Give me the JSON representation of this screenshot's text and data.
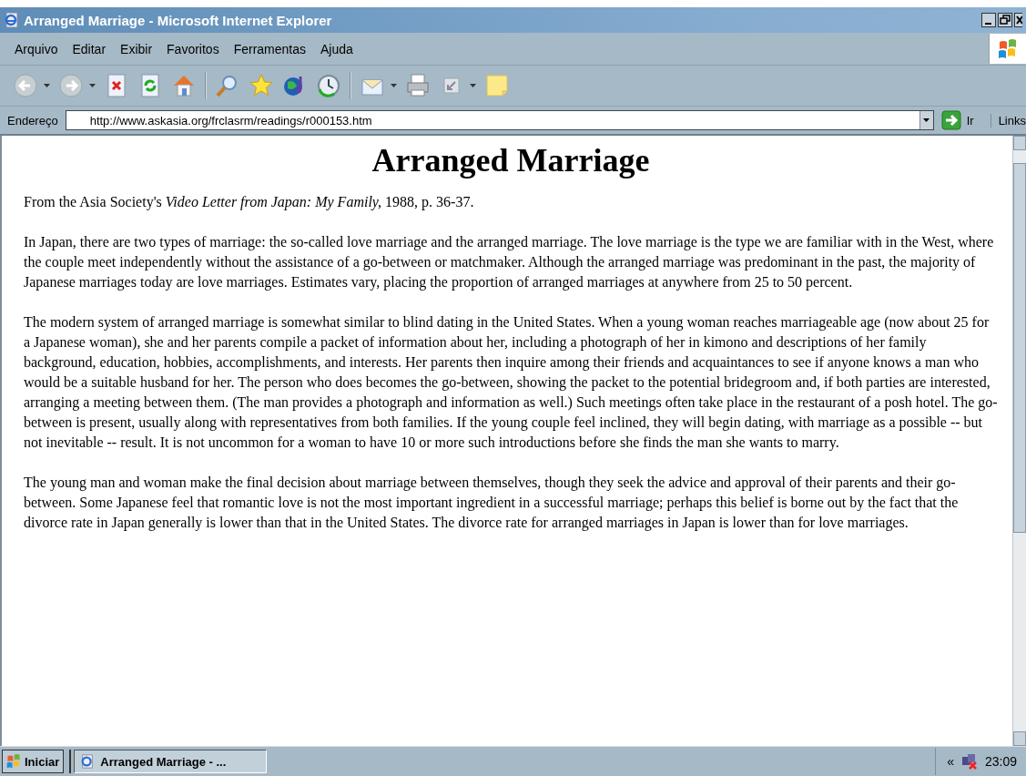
{
  "window": {
    "title": "Arranged Marriage - Microsoft Internet Explorer"
  },
  "menu": [
    "Arquivo",
    "Editar",
    "Exibir",
    "Favoritos",
    "Ferramentas",
    "Ajuda"
  ],
  "address_bar": {
    "label": "Endereço",
    "value": "http://www.askasia.org/frclasrm/readings/r000153.htm",
    "go": "Ir",
    "links": "Links"
  },
  "page": {
    "heading": "Arranged Marriage",
    "paragraphs": [
      "From the Asia Society's *Video Letter from Japan: My Family,* 1988, p. 36-37.",
      "In Japan, there are two types of marriage: the so-called love marriage and the arranged marriage. The love marriage is the type we are familiar with in the West, where the couple meet independently without the assistance of a go-between or matchmaker. Although the arranged marriage was predominant in the past, the majority of Japanese marriages today are love marriages. Estimates vary, placing the proportion of arranged marriages at anywhere from 25 to 50 percent.",
      "The modern system of arranged marriage is somewhat similar to blind dating in the United States. When a young woman reaches marriageable age (now about 25 for a Japanese woman), she and her parents compile a packet of information about her, including a photograph of her in kimono and descriptions of her family background, education, hobbies, accomplishments, and interests. Her parents then inquire among their friends and acquaintances to see if anyone knows a man who would be a suitable husband for her. The person who does becomes the go-between, showing the packet to the potential bridegroom and, if both parties are interested, arranging a meeting between them. (The man provides a photograph and information as well.) Such meetings often take place in the restaurant of a posh hotel. The go-between is present, usually along with representatives from both families. If the young couple feel inclined, they will begin dating, with marriage as a possible -- but not inevitable -- result. It is not uncommon for a woman to have 10 or more such introductions before she finds the man she wants to marry.",
      "The young man and woman make the final decision about marriage between themselves, though they seek the advice and approval of their parents and their go-between. Some Japanese feel that romantic love is not the most important ingredient in a successful marriage; perhaps this belief is borne out by the fact that the divorce rate in Japan generally is lower than that in the United States. The divorce rate for arranged marriages in Japan is lower than for love marriages."
    ]
  },
  "taskbar": {
    "start": "Iniciar",
    "tasks": [
      {
        "label": "Arranged Marriage - ...",
        "selected": true
      }
    ],
    "tray_toggle": "«",
    "clock": "23:09"
  }
}
